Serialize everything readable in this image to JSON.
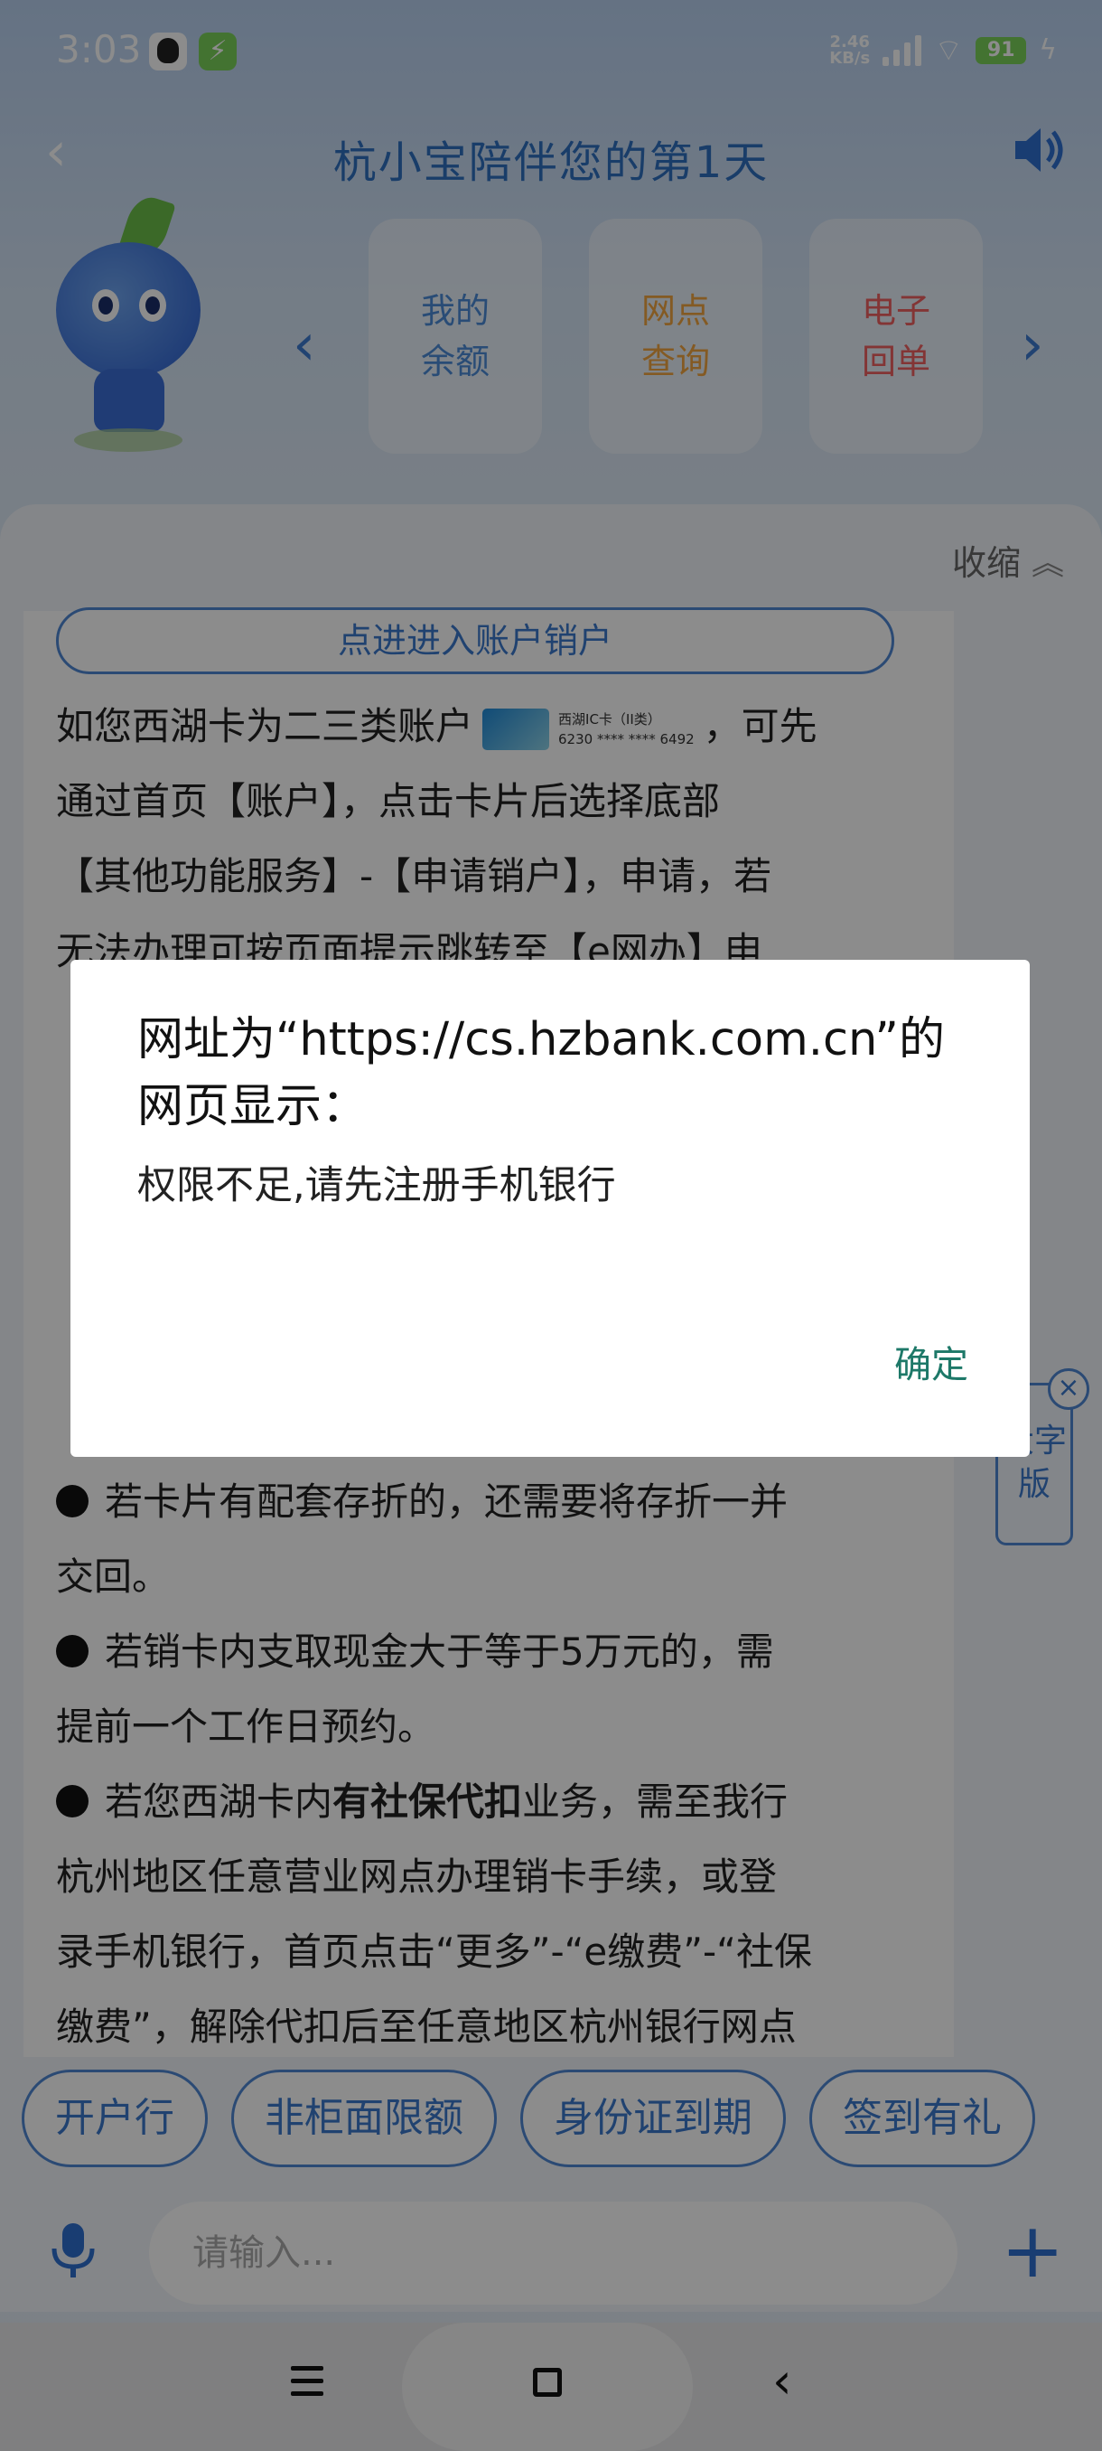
{
  "status_bar": {
    "time": "3:03",
    "net_speed_top": "2.46",
    "net_speed_bottom": "KB/s",
    "battery": "91"
  },
  "header": {
    "title": "杭小宝陪伴您的第1天"
  },
  "quick_cards": [
    {
      "line1": "我的",
      "line2": "余额",
      "color": "#4b8bd8"
    },
    {
      "line1": "网点",
      "line2": "查询",
      "color": "#f0a540"
    },
    {
      "line1": "电子",
      "line2": "回单",
      "color": "#ee6262"
    }
  ],
  "panel": {
    "collapse_label": "收缩"
  },
  "chat": {
    "account_button": "点进进入账户销户",
    "para1_part1": "如您西湖卡为二三类账户",
    "card_name": "西湖IC卡（II类）",
    "card_number": "6230 **** **** 6492",
    "para1_part2": "，可先",
    "para1_line2": "通过首页【账户】，点击卡片后选择底部",
    "para1_line3": "【其他功能服务】-【申请销户】，申请，若",
    "para1_line4": "无法办理可按页面提示跳转至【e网办】申",
    "bullet1_line1": "若卡片有配套存折的，还需要将存折一并",
    "bullet1_line2": "交回。",
    "bullet2_line1": "若销卡内支取现金大于等于5万元的，需",
    "bullet2_line2": "提前一个工作日预约。",
    "bullet3_pre": "若您西湖卡内",
    "bullet3_bold": "有社保代扣",
    "bullet3_post": "业务，需至我行",
    "bullet3_line2": "杭州地区任意营业网点办理销卡手续，或登",
    "bullet3_line3": "录手机银行，首页点击“更多”-“e缴费”-“社保",
    "bullet3_line4": "缴费”，解除代扣后至任意地区杭州银行网点"
  },
  "big_font": {
    "label": "大字版",
    "close": "×"
  },
  "chips": [
    "开户行",
    "非柜面限额",
    "身份证到期",
    "签到有礼"
  ],
  "input": {
    "placeholder": "请输入..."
  },
  "dialog": {
    "title": "网址为“https://cs.hzbank.com.cn”的网页显示：",
    "message": "权限不足,请先注册手机银行",
    "ok_label": "确定"
  },
  "icons": {
    "back": "chevron-left-icon",
    "speaker": "speaker-icon",
    "mic": "microphone-icon",
    "plus": "plus-icon"
  }
}
